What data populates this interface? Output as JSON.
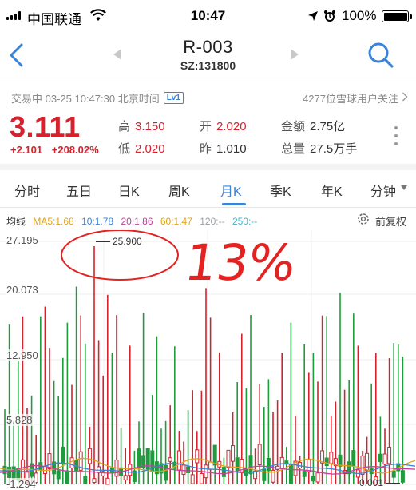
{
  "status": {
    "carrier": "中国联通",
    "time": "10:47",
    "battery": "100%",
    "icons": [
      "signal-icon",
      "wifi-icon",
      "location-icon",
      "alarm-icon",
      "battery-icon"
    ]
  },
  "nav": {
    "title": "R-003",
    "code": "SZ:131800",
    "icons": [
      "back-chevron-icon",
      "prev-triangle-icon",
      "next-triangle-icon",
      "search-icon"
    ]
  },
  "quote": {
    "trade_info": "交易中 03-25 10:47:30 北京时间",
    "level": "Lv1",
    "followers": "4277位雪球用户关注",
    "price": "3.111",
    "change": "+2.101",
    "change_pct": "+208.02%",
    "high_label": "高",
    "high": "3.150",
    "low_label": "低",
    "low": "2.020",
    "open_label": "开",
    "open": "2.020",
    "prev_label": "昨",
    "prev": "1.010",
    "amount_label": "金额",
    "amount": "2.75亿",
    "volume_label": "总量",
    "volume": "27.5万手"
  },
  "tabs": [
    "分时",
    "五日",
    "日K",
    "周K",
    "月K",
    "季K",
    "年K",
    "分钟"
  ],
  "active_tab": "月K",
  "ma": {
    "label": "均线",
    "items": [
      {
        "text": "MA5:1.68",
        "color": "#e0a21b"
      },
      {
        "text": "10:1.78",
        "color": "#3a83d8"
      },
      {
        "text": "20:1.86",
        "color": "#c2419b"
      },
      {
        "text": "60:1.47",
        "color": "#e0a21b"
      },
      {
        "text": "120:--",
        "color": "#9aa0a6"
      },
      {
        "text": "250:--",
        "color": "#3fb6c8"
      }
    ],
    "restore_label": "前复权"
  },
  "chart_data": {
    "type": "candlestick",
    "y_ticks": [
      "27.195",
      "20.073",
      "12.950",
      "5.828",
      "-1.294"
    ],
    "ylim": [
      -1.294,
      27.195
    ],
    "max_label": "25.900",
    "min_label": "0.001",
    "handwritten_note": "13%",
    "colors": {
      "up": "#1f9b3c",
      "down": "#d6222d"
    }
  }
}
